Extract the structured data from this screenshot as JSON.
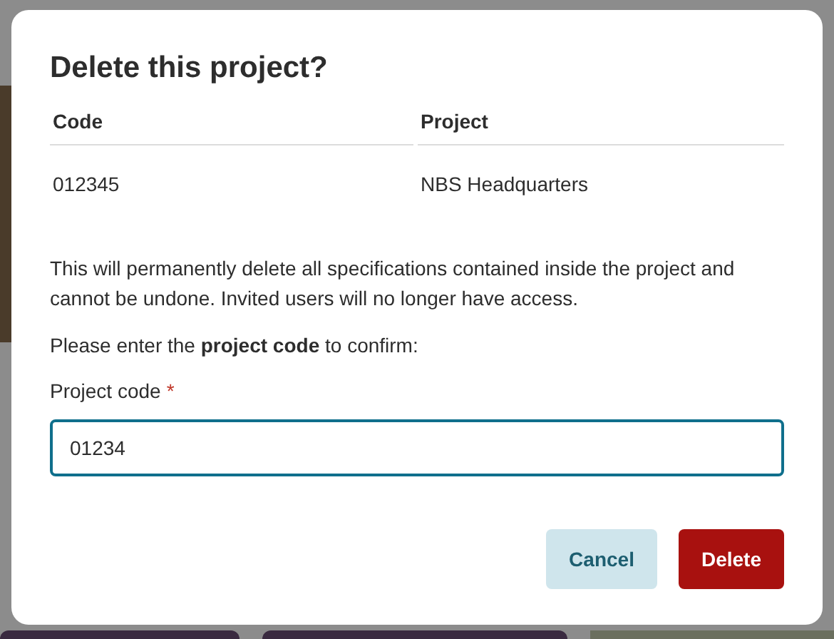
{
  "dialog": {
    "title": "Delete this project?",
    "table": {
      "columns": [
        "Code",
        "Project"
      ],
      "rows": [
        [
          "012345",
          "NBS Headquarters"
        ]
      ]
    },
    "warning": "This will permanently delete all specifications contained inside the project and cannot be undone. Invited users will no longer have access.",
    "instruction": "Please enter the **project code** to confirm:",
    "field": {
      "label": "Project code",
      "required_mark": "*",
      "value": "01234"
    },
    "buttons": [
      {
        "label": "Cancel",
        "kind": "secondary"
      },
      {
        "label": "Delete",
        "kind": "danger"
      }
    ]
  }
}
